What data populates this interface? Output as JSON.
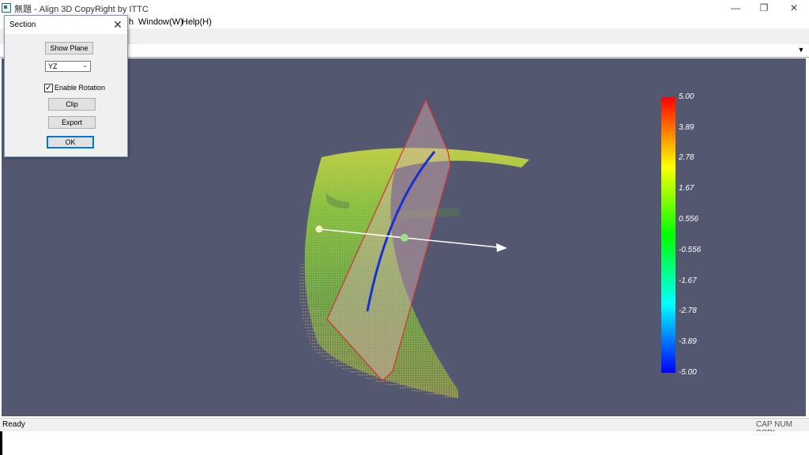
{
  "window": {
    "title": "無題 - Align 3D CopyRight by ITTC",
    "minimize_icon": "minimize-icon",
    "restore_icon": "restore-icon",
    "close_icon": "close-icon"
  },
  "menubar": {
    "items": [
      {
        "label": "h"
      },
      {
        "label": "Window(W)"
      },
      {
        "label": "Help(H)"
      }
    ]
  },
  "status": {
    "text": "Ready",
    "indicators": "CAP  NUM  SCRL"
  },
  "dialog": {
    "title": "Section",
    "show_plane_label": "Show Plane",
    "plane_select_value": "YZ",
    "enable_rotation_label": "Enable Rotation",
    "enable_rotation_checked": true,
    "clip_label": "Clip",
    "export_label": "Export",
    "ok_label": "OK"
  },
  "colorbar": {
    "labels": [
      "5.00",
      "3.89",
      "2.78",
      "1.67",
      "0.556",
      "-0.556",
      "-1.67",
      "-2.78",
      "-3.89",
      "-5.00"
    ],
    "max": 5.0,
    "min": -5.0,
    "colors": [
      "#ff0000",
      "#ffff00",
      "#00ff00",
      "#00ffff",
      "#0000ff"
    ]
  },
  "viewport": {
    "background": "#535870",
    "plane_color": "#cc3333",
    "section_curve_color": "#1a2fd0"
  }
}
